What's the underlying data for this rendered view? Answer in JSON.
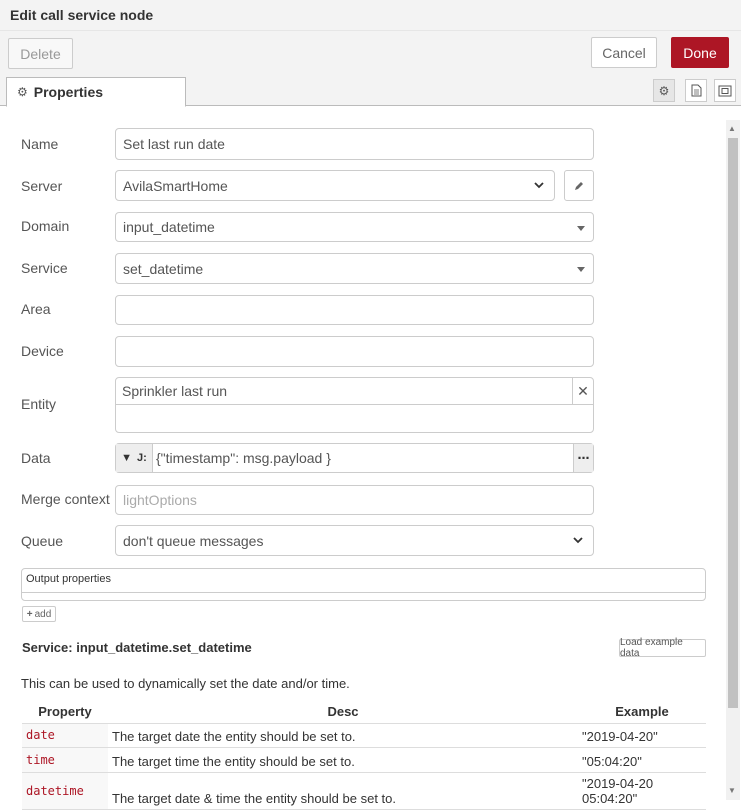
{
  "header": {
    "title": "Edit call service node"
  },
  "toolbar": {
    "delete_label": "Delete",
    "cancel_label": "Cancel",
    "done_label": "Done"
  },
  "tabs": [
    {
      "label": "Properties",
      "icon": "gear-icon"
    }
  ],
  "tab_icons": [
    "gear-icon",
    "document-icon",
    "frame-icon"
  ],
  "form": {
    "name": {
      "label": "Name",
      "value": "Set last run date"
    },
    "server": {
      "label": "Server",
      "value": "AvilaSmartHome"
    },
    "domain": {
      "label": "Domain",
      "value": "input_datetime"
    },
    "service": {
      "label": "Service",
      "value": "set_datetime"
    },
    "area": {
      "label": "Area",
      "value": ""
    },
    "device": {
      "label": "Device",
      "value": ""
    },
    "entity": {
      "label": "Entity",
      "value": "Sprinkler last run"
    },
    "data": {
      "label": "Data",
      "type_glyph": "J:",
      "value": "{\"timestamp\": msg.payload }"
    },
    "merge_context": {
      "label": "Merge context",
      "placeholder": "lightOptions"
    },
    "queue": {
      "label": "Queue",
      "value": "don't queue messages"
    }
  },
  "output": {
    "label": "Output properties",
    "add_label": "add"
  },
  "service_info": {
    "title": "Service: input_datetime.set_datetime",
    "load_example_label": "Load example data",
    "description": "This can be used to dynamically set the date and/or time.",
    "columns": [
      "Property",
      "Desc",
      "Example"
    ],
    "rows": [
      {
        "property": "date",
        "desc": "The target date the entity should be set to.",
        "example": "\"2019-04-20\""
      },
      {
        "property": "time",
        "desc": "The target time the entity should be set to.",
        "example": "\"05:04:20\""
      },
      {
        "property": "datetime",
        "desc": "The target date & time the entity should be set to.",
        "example": "\"2019-04-20 05:04:20\""
      }
    ]
  },
  "colors": {
    "accent": "#ad1625",
    "header_bg": "#f3f3f3",
    "border": "#cccccc"
  }
}
